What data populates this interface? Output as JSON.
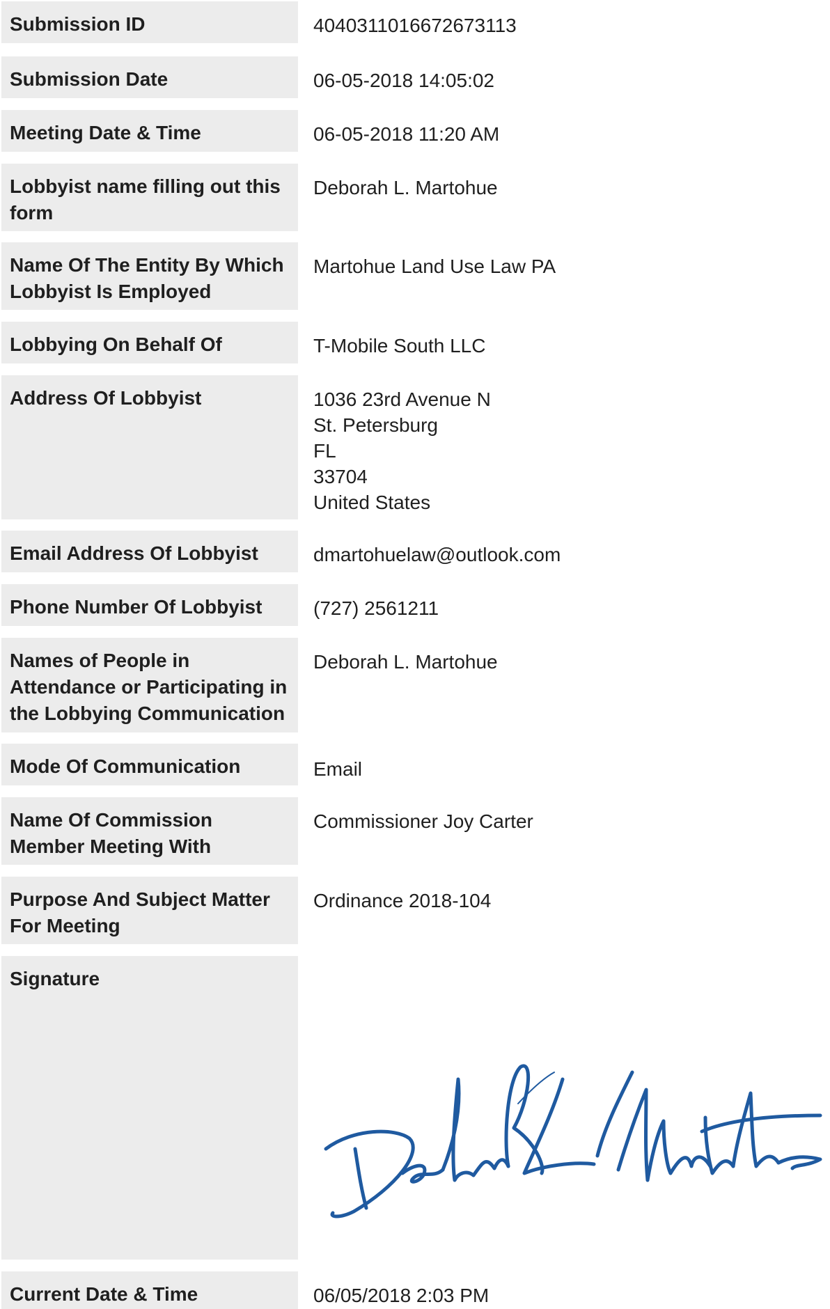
{
  "fields": [
    {
      "label": "Submission ID",
      "value": "4040311016672673113"
    },
    {
      "label": "Submission Date",
      "value": "06-05-2018 14:05:02"
    },
    {
      "label": "Meeting Date & Time",
      "value": "06-05-2018 11:20 AM"
    },
    {
      "label": "Lobbyist name filling out this form",
      "value": "Deborah L. Martohue"
    },
    {
      "label": "Name Of The Entity By Which Lobbyist Is Employed",
      "value": "Martohue Land Use Law PA"
    },
    {
      "label": "Lobbying On Behalf Of",
      "value": "T-Mobile South LLC"
    },
    {
      "label": "Address Of Lobbyist",
      "value_lines": [
        "1036 23rd Avenue N",
        "St. Petersburg",
        "FL",
        "33704",
        "United States"
      ]
    },
    {
      "label": "Email Address Of Lobbyist",
      "value": "dmartohuelaw@outlook.com"
    },
    {
      "label": "Phone Number Of Lobbyist",
      "value": "(727) 2561211"
    },
    {
      "label": "Names of People in Attendance or Participating in the Lobbying Communication",
      "value": "Deborah L. Martohue"
    },
    {
      "label": "Mode Of Communication",
      "value": "Email"
    },
    {
      "label": "Name Of Commission Member Meeting With",
      "value": "Commissioner Joy Carter"
    },
    {
      "label": "Purpose And Subject Matter For Meeting",
      "value": "Ordinance 2018-104"
    },
    {
      "label": "Signature",
      "value": "Deborah L. Martohue"
    },
    {
      "label": "Current Date & Time",
      "value": "06/05/2018 2:03 PM"
    }
  ],
  "colors": {
    "label_background": "#ececec",
    "signature_ink": "#1f5aa0"
  }
}
